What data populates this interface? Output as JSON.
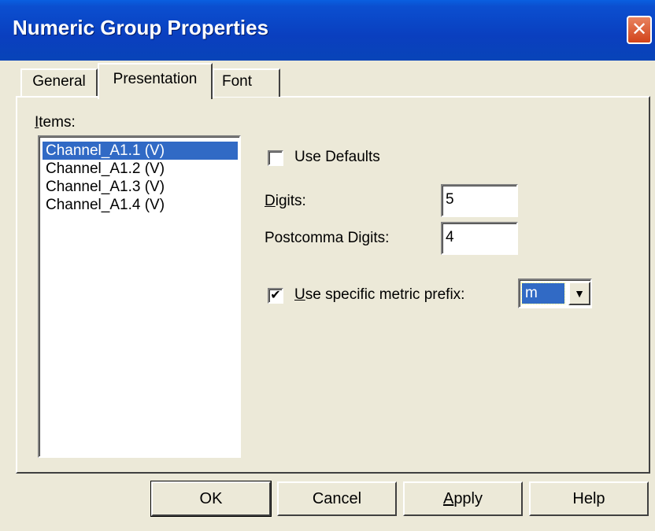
{
  "window": {
    "title": "Numeric Group Properties",
    "close_glyph": "✕"
  },
  "tabs": [
    {
      "label": "General"
    },
    {
      "label": "Presentation"
    },
    {
      "label": "Font"
    }
  ],
  "items_section": {
    "label_prefix": "I",
    "label_rest": "tems:",
    "items": [
      "Channel_A1.1 (V)",
      "Channel_A1.2 (V)",
      "Channel_A1.3 (V)",
      "Channel_A1.4 (V)"
    ]
  },
  "use_defaults": {
    "label": "Use Defaults",
    "checked": false
  },
  "digits": {
    "label_prefix": "D",
    "label_rest": "igits:",
    "value": "5"
  },
  "postcomma_digits": {
    "label": "Postcomma Digits:",
    "value": "4"
  },
  "metric_prefix": {
    "check_glyph": "✔",
    "label_prefix": "U",
    "label_rest": "se specific metric prefix:",
    "checked": true,
    "selected": "m",
    "dropdown_glyph": "▼"
  },
  "buttons": {
    "ok": "OK",
    "cancel": "Cancel",
    "apply_prefix": "A",
    "apply_rest": "pply",
    "help": "Help"
  }
}
